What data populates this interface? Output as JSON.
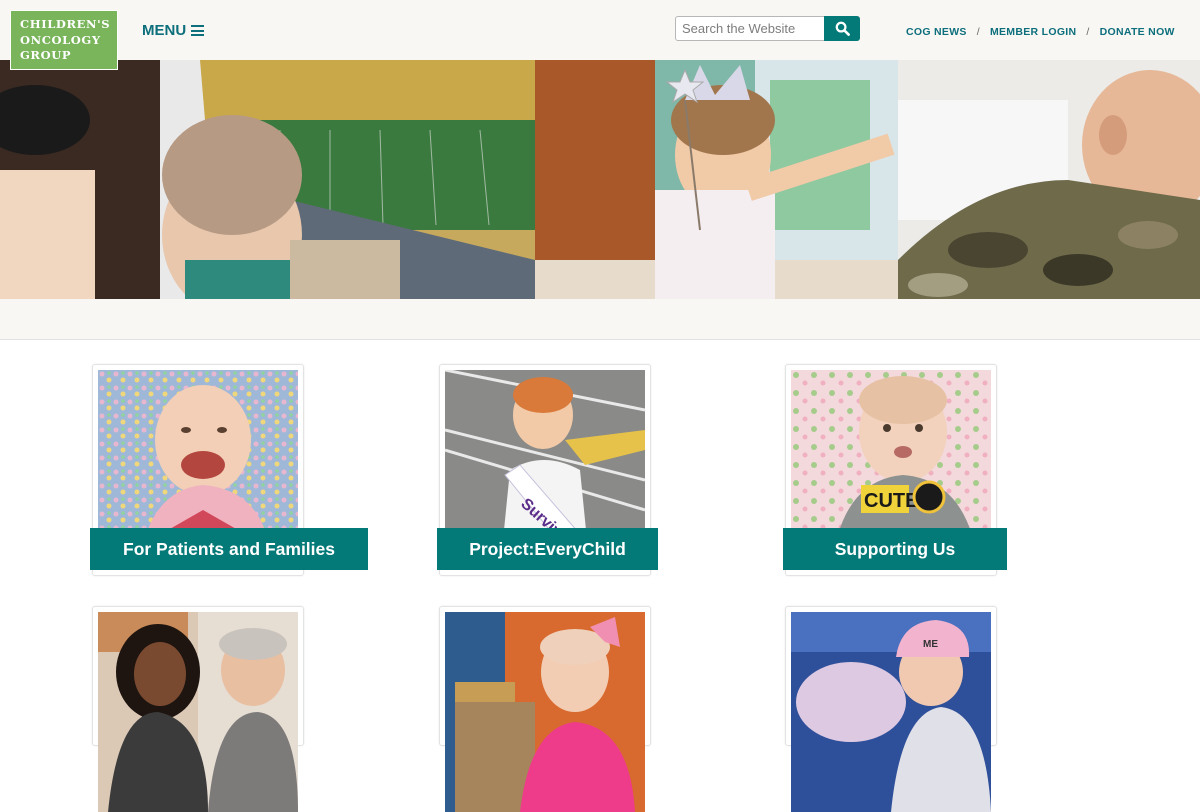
{
  "logo": {
    "line1": "CHILDREN'S",
    "line2": "ONCOLOGY",
    "line3": "GROUP"
  },
  "header": {
    "menu_label": "MENU",
    "search_placeholder": "Search the Website",
    "links": [
      "COG NEWS",
      "MEMBER LOGIN",
      "DONATE NOW"
    ],
    "link_separator": "/"
  },
  "colors": {
    "accent": "#047a78",
    "logo_green": "#7ab55c",
    "nav_text": "#0e6f7c",
    "header_bg": "#f8f7f4"
  },
  "cards": [
    {
      "label": "For Patients and Families"
    },
    {
      "label": "Project:EveryChild",
      "photo_text": "Surviv"
    },
    {
      "label": "Supporting Us",
      "photo_text": "CUTE"
    },
    {
      "label": ""
    },
    {
      "label": ""
    },
    {
      "label": "",
      "photo_text": "ME"
    }
  ]
}
